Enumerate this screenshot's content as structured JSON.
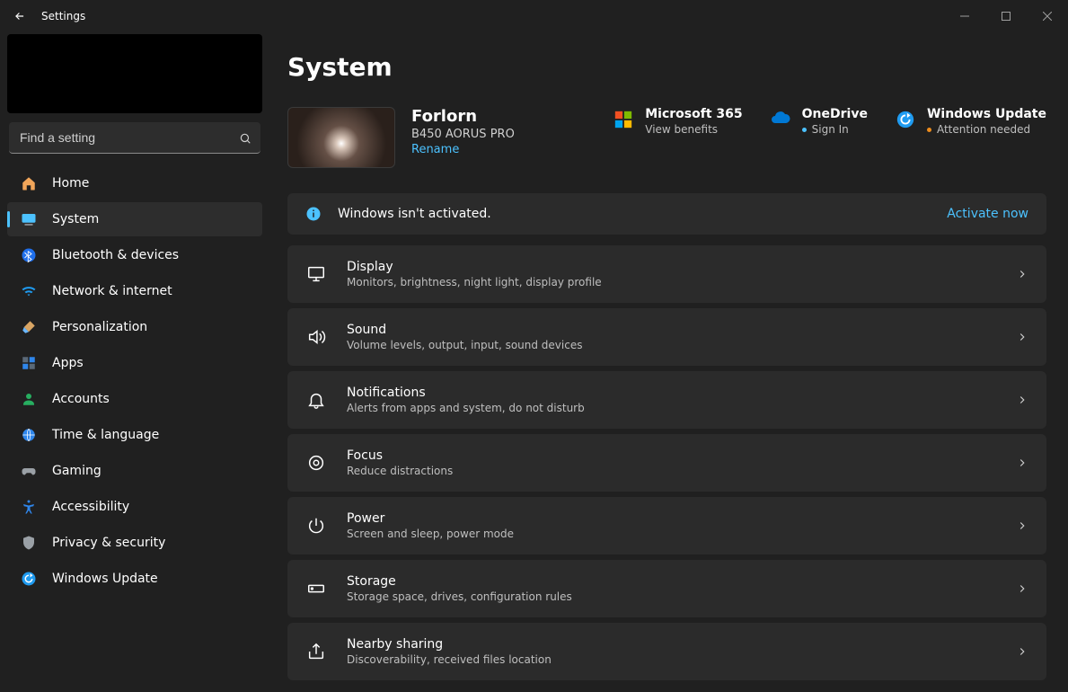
{
  "window": {
    "title": "Settings"
  },
  "sidebar": {
    "search_placeholder": "Find a setting",
    "items": [
      {
        "label": "Home"
      },
      {
        "label": "System"
      },
      {
        "label": "Bluetooth & devices"
      },
      {
        "label": "Network & internet"
      },
      {
        "label": "Personalization"
      },
      {
        "label": "Apps"
      },
      {
        "label": "Accounts"
      },
      {
        "label": "Time & language"
      },
      {
        "label": "Gaming"
      },
      {
        "label": "Accessibility"
      },
      {
        "label": "Privacy & security"
      },
      {
        "label": "Windows Update"
      }
    ]
  },
  "page": {
    "title": "System",
    "pc": {
      "name": "Forlorn",
      "model": "B450 AORUS PRO",
      "rename_label": "Rename"
    },
    "status": {
      "m365": {
        "title": "Microsoft 365",
        "sub": "View benefits"
      },
      "onedrive": {
        "title": "OneDrive",
        "sub": "Sign In"
      },
      "update": {
        "title": "Windows Update",
        "sub": "Attention needed"
      }
    },
    "banner": {
      "message": "Windows isn't activated.",
      "action": "Activate now"
    },
    "cards": [
      {
        "title": "Display",
        "sub": "Monitors, brightness, night light, display profile"
      },
      {
        "title": "Sound",
        "sub": "Volume levels, output, input, sound devices"
      },
      {
        "title": "Notifications",
        "sub": "Alerts from apps and system, do not disturb"
      },
      {
        "title": "Focus",
        "sub": "Reduce distractions"
      },
      {
        "title": "Power",
        "sub": "Screen and sleep, power mode"
      },
      {
        "title": "Storage",
        "sub": "Storage space, drives, configuration rules"
      },
      {
        "title": "Nearby sharing",
        "sub": "Discoverability, received files location"
      }
    ]
  }
}
